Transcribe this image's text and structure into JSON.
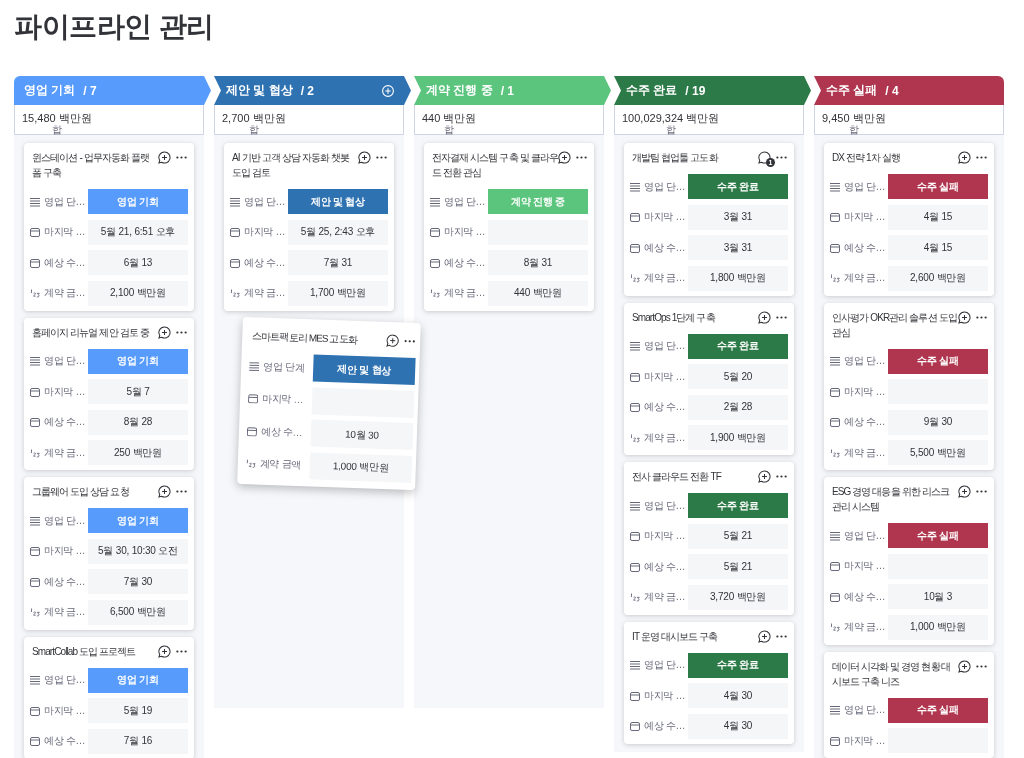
{
  "title": "파이프라인 관리",
  "columns": [
    {
      "name": "영업 기회",
      "count": "/ 7",
      "color": "#579bfc",
      "add_icon": false,
      "total": "15,480 백만원",
      "total_label": "합",
      "cards": [
        {
          "title": "윈스테이션 - 업무자동화 플랫폼 구축",
          "dragging": false,
          "fields": [
            {
              "kind": "status",
              "label": "영업 단…",
              "value": "영업 기회"
            },
            {
              "kind": "date",
              "label": "마지막 …",
              "value": "5월 21, 6:51 오후"
            },
            {
              "kind": "date",
              "label": "예상 수…",
              "value": "6월 13"
            },
            {
              "kind": "number",
              "label": "계약 금…",
              "value": "2,100 백만원"
            }
          ]
        },
        {
          "title": "홈페이지 리뉴얼 제안 검토 중",
          "dragging": false,
          "fields": [
            {
              "kind": "status",
              "label": "영업 단…",
              "value": "영업 기회"
            },
            {
              "kind": "date",
              "label": "마지막 …",
              "value": "5월 7"
            },
            {
              "kind": "date",
              "label": "예상 수…",
              "value": "8월 28"
            },
            {
              "kind": "number",
              "label": "계약 금…",
              "value": "250 백만원"
            }
          ]
        },
        {
          "title": "그룹웨어 도입 상담 요청",
          "dragging": false,
          "fields": [
            {
              "kind": "status",
              "label": "영업 단…",
              "value": "영업 기회"
            },
            {
              "kind": "date",
              "label": "마지막 …",
              "value": "5월 30, 10:30 오전"
            },
            {
              "kind": "date",
              "label": "예상 수…",
              "value": "7월 30"
            },
            {
              "kind": "number",
              "label": "계약 금…",
              "value": "6,500 백만원"
            }
          ]
        },
        {
          "title": "SmartCollab 도입 프로젝트",
          "dragging": false,
          "fields": [
            {
              "kind": "status",
              "label": "영업 단…",
              "value": "영업 기회"
            },
            {
              "kind": "date",
              "label": "마지막 …",
              "value": "5월 19"
            },
            {
              "kind": "date",
              "label": "예상 수…",
              "value": "7월 16"
            }
          ]
        }
      ]
    },
    {
      "name": "제안 및 협상",
      "count": "/ 2",
      "color": "#2f72b2",
      "add_icon": true,
      "total": "2,700 백만원",
      "total_label": "합",
      "cards": [
        {
          "title": "AI 기반 고객 상담 자동화 챗봇 도입 검토",
          "dragging": false,
          "fields": [
            {
              "kind": "status",
              "label": "영업 단…",
              "value": "제안 및 협상"
            },
            {
              "kind": "date",
              "label": "마지막 …",
              "value": "5월 25, 2:43 오후"
            },
            {
              "kind": "date",
              "label": "예상 수…",
              "value": "7월 31"
            },
            {
              "kind": "number",
              "label": "계약 금…",
              "value": "1,700 백만원"
            }
          ]
        },
        {
          "title": "스마트팩토리 MES 고도화",
          "dragging": true,
          "fields": [
            {
              "kind": "status",
              "label": "영업 단계",
              "value": "제안 및 협상"
            },
            {
              "kind": "date",
              "label": "마지막 …"
            },
            {
              "kind": "date",
              "label": "예상 수…",
              "value": "10월 30"
            },
            {
              "kind": "number",
              "label": "계약 금액",
              "value": "1,000 백만원"
            }
          ]
        }
      ]
    },
    {
      "name": "계약 진행 중",
      "count": "/ 1",
      "color": "#5bc57d",
      "add_icon": false,
      "total": "440 백만원",
      "total_label": "합",
      "cards": [
        {
          "title": "전자결재 시스템 구축 및 클라우드 전환 관심",
          "dragging": false,
          "fields": [
            {
              "kind": "status",
              "label": "영업 단…",
              "value": "계약 진행 중"
            },
            {
              "kind": "date",
              "label": "마지막 …"
            },
            {
              "kind": "date",
              "label": "예상 수…",
              "value": "8월 31"
            },
            {
              "kind": "number",
              "label": "계약 금…",
              "value": "440 백만원"
            }
          ]
        }
      ]
    },
    {
      "name": "수주 완료",
      "count": "/ 19",
      "color": "#2c7a47",
      "add_icon": false,
      "total": "100,029,324 백만원",
      "total_label": "합",
      "cards": [
        {
          "title": "개발팀 협업툴 고도화",
          "dragging": false,
          "comment_count": "1",
          "fields": [
            {
              "kind": "status",
              "label": "영업 단…",
              "value": "수주 완료"
            },
            {
              "kind": "date",
              "label": "마지막 …",
              "value": "3월 31"
            },
            {
              "kind": "date",
              "label": "예상 수…",
              "value": "3월 31"
            },
            {
              "kind": "number",
              "label": "계약 금…",
              "value": "1,800 백만원"
            }
          ]
        },
        {
          "title": "SmartOps 1단계 구축",
          "dragging": false,
          "fields": [
            {
              "kind": "status",
              "label": "영업 단…",
              "value": "수주 완료"
            },
            {
              "kind": "date",
              "label": "마지막 …",
              "value": "5월 20"
            },
            {
              "kind": "date",
              "label": "예상 수…",
              "value": "2월 28"
            },
            {
              "kind": "number",
              "label": "계약 금…",
              "value": "1,900 백만원"
            }
          ]
        },
        {
          "title": "전사 클라우드 전환 TF",
          "dragging": false,
          "fields": [
            {
              "kind": "status",
              "label": "영업 단…",
              "value": "수주 완료"
            },
            {
              "kind": "date",
              "label": "마지막 …",
              "value": "5월 21"
            },
            {
              "kind": "date",
              "label": "예상 수…",
              "value": "5월 21"
            },
            {
              "kind": "number",
              "label": "계약 금…",
              "value": "3,720 백만원"
            }
          ]
        },
        {
          "title": "IT 운영 대시보드 구축",
          "dragging": false,
          "fields": [
            {
              "kind": "status",
              "label": "영업 단…",
              "value": "수주 완료"
            },
            {
              "kind": "date",
              "label": "마지막 …",
              "value": "4월 30"
            },
            {
              "kind": "date",
              "label": "예상 수…",
              "value": "4월 30"
            }
          ]
        }
      ]
    },
    {
      "name": "수주 실패",
      "count": "/ 4",
      "color": "#b0364f",
      "add_icon": false,
      "total": "9,450 백만원",
      "total_label": "합",
      "cards": [
        {
          "title": "DX 전략 1차 실행",
          "dragging": false,
          "fields": [
            {
              "kind": "status",
              "label": "영업 단…",
              "value": "수주 실패"
            },
            {
              "kind": "date",
              "label": "마지막 …",
              "value": "4월 15"
            },
            {
              "kind": "date",
              "label": "예상 수…",
              "value": "4월 15"
            },
            {
              "kind": "number",
              "label": "계약 금…",
              "value": "2,600 백만원"
            }
          ]
        },
        {
          "title": "인사평가 OKR관리 솔루션 도입 관심",
          "dragging": false,
          "fields": [
            {
              "kind": "status",
              "label": "영업 단…",
              "value": "수주 실패"
            },
            {
              "kind": "date",
              "label": "마지막 …"
            },
            {
              "kind": "date",
              "label": "예상 수…",
              "value": "9월 30"
            },
            {
              "kind": "number",
              "label": "계약 금…",
              "value": "5,500 백만원"
            }
          ]
        },
        {
          "title": "ESG 경영 대응을 위한 리스크 관리 시스템",
          "dragging": false,
          "fields": [
            {
              "kind": "status",
              "label": "영업 단…",
              "value": "수주 실패"
            },
            {
              "kind": "date",
              "label": "마지막 …"
            },
            {
              "kind": "date",
              "label": "예상 수…",
              "value": "10월 3"
            },
            {
              "kind": "number",
              "label": "계약 금…",
              "value": "1,000 백만원"
            }
          ]
        },
        {
          "title": "데이터 시각화 및 경영 현황 대시보드 구축 니즈",
          "dragging": false,
          "fields": [
            {
              "kind": "status",
              "label": "영업 단…",
              "value": "수주 실패"
            },
            {
              "kind": "date",
              "label": "마지막 …"
            }
          ]
        }
      ]
    }
  ]
}
